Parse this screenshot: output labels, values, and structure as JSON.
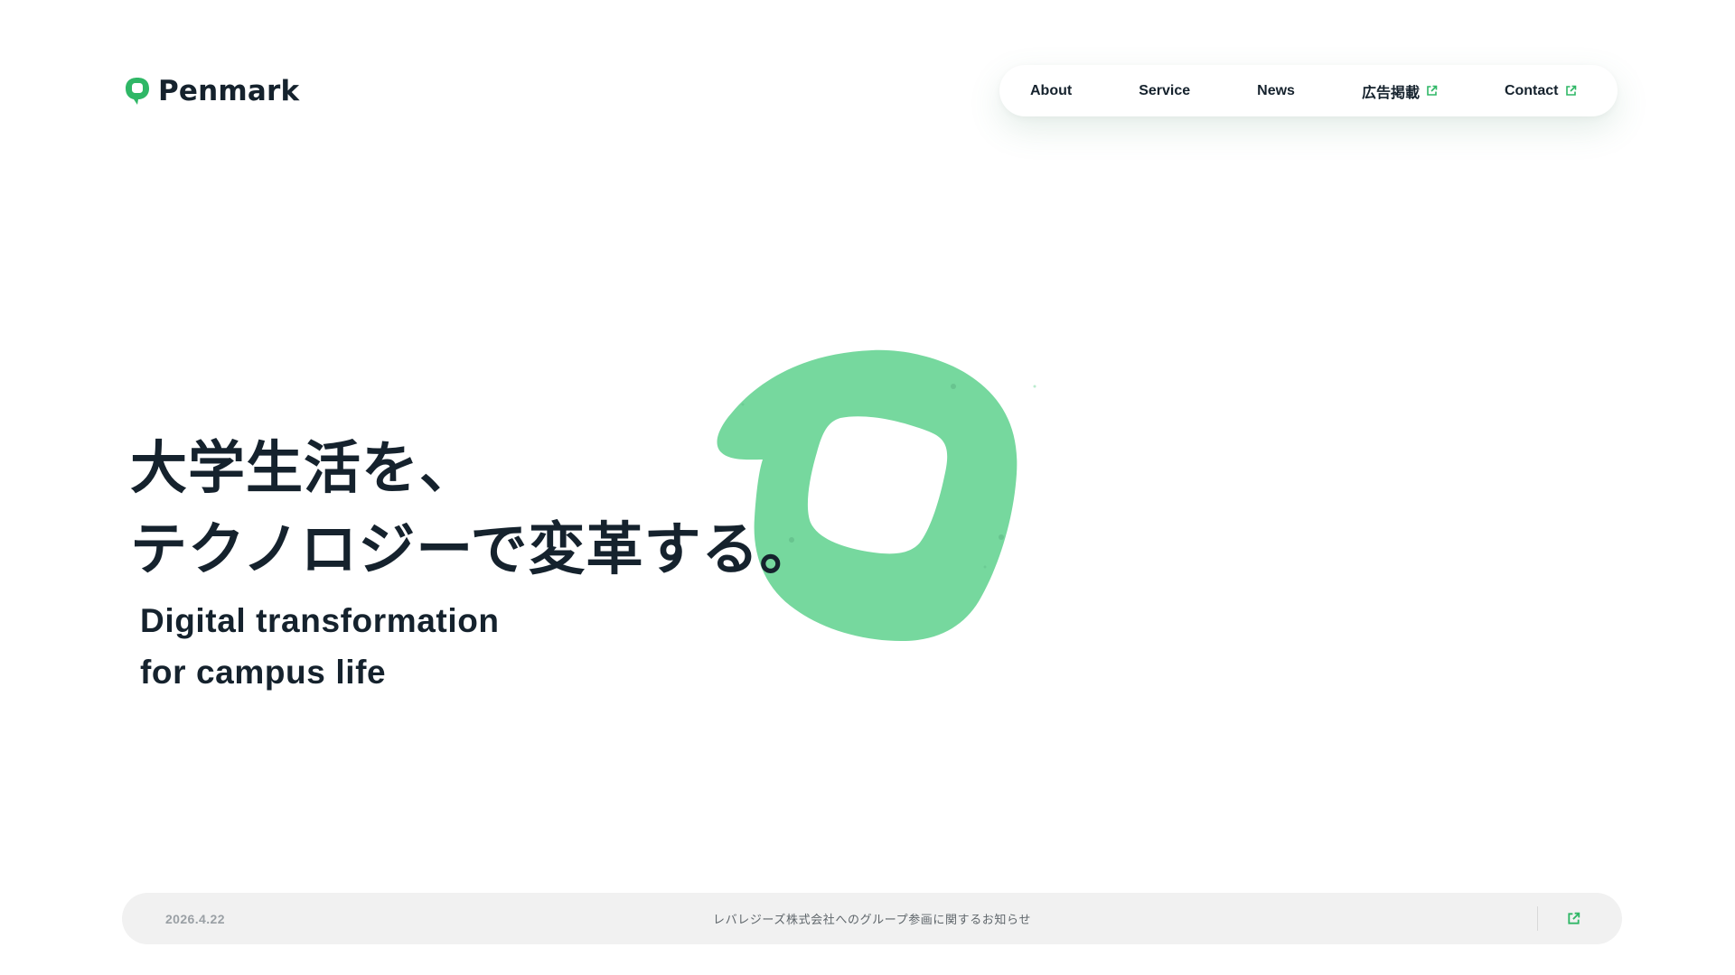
{
  "header": {
    "logo_text": "Penmark",
    "logo_icon": "penmark-logo-icon",
    "nav": [
      {
        "label": "About",
        "external": false
      },
      {
        "label": "Service",
        "external": false
      },
      {
        "label": "News",
        "external": false
      },
      {
        "label": "広告掲載",
        "external": true,
        "icon": "external-link-icon"
      },
      {
        "label": "Contact",
        "external": true,
        "icon": "external-link-icon"
      }
    ]
  },
  "hero": {
    "headline_jp": [
      "大学生活を、",
      "テクノロジーで変革する。"
    ],
    "headline_en": [
      "Digital transformation",
      "for campus life"
    ],
    "graphic": "penmark-blob-logo"
  },
  "news": {
    "date": "2026.4.22",
    "title": "レバレジーズ株式会社へのグループ参画に関するお知らせ",
    "icon": "external-link-icon"
  },
  "colors": {
    "brand_green": "#2fb766",
    "blob_green": "#76d89e",
    "text_dark": "#15222d",
    "news_bg": "#f1f1f1"
  }
}
